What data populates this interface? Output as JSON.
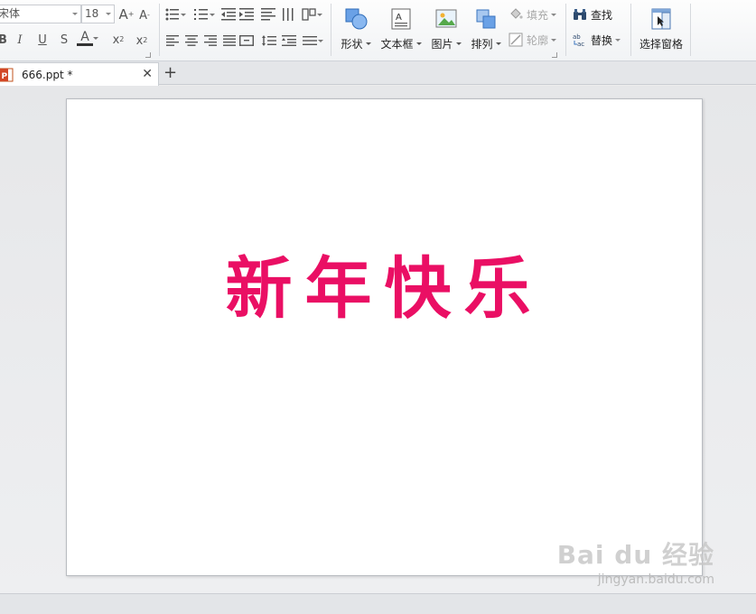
{
  "ribbon": {
    "font": {
      "font_name": "宋体",
      "font_size": "18"
    },
    "insert": {
      "shape_label": "形状",
      "textbox_label": "文本框",
      "picture_label": "图片",
      "arrange_label": "排列",
      "fill_label": "填充",
      "outline_label": "轮廓"
    },
    "edit": {
      "find_label": "查找",
      "replace_label": "替换",
      "selection_pane_label": "选择窗格"
    }
  },
  "tabs": {
    "document_name": "666.ppt *",
    "close_glyph": "✕",
    "add_glyph": "+"
  },
  "slide": {
    "text": "新年快乐",
    "text_color": "#ea0f64"
  },
  "watermark": {
    "logo": "Bai du 经验",
    "url": "jingyan.baidu.com"
  }
}
